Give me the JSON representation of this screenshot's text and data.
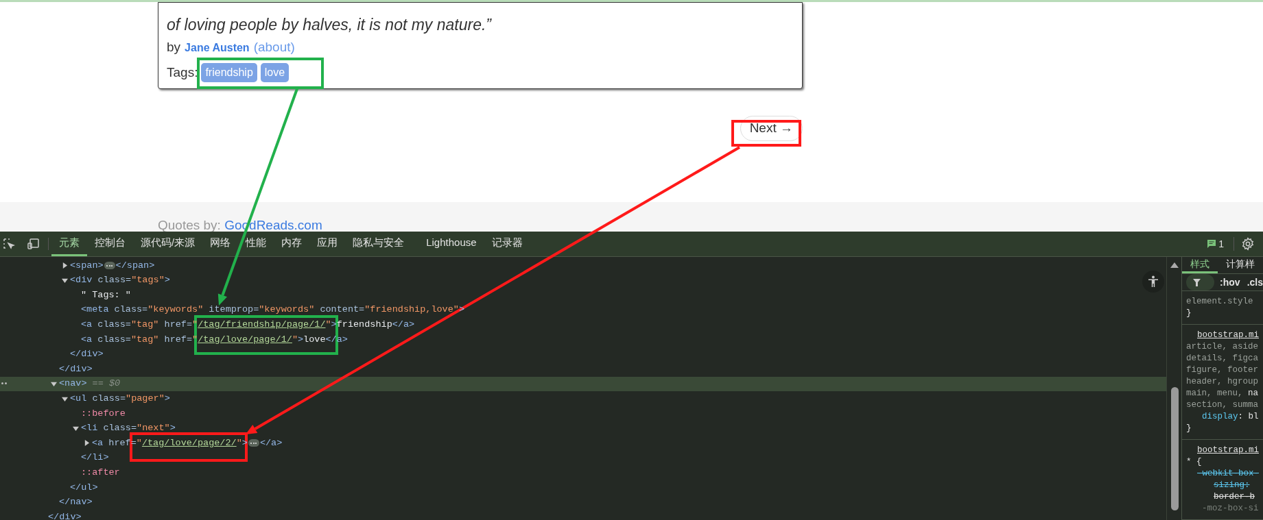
{
  "page": {
    "quote_lines": [
      "of loving people by halves, it is not my nature.”"
    ],
    "by_label": "by",
    "author": "Jane Austen",
    "about_link": "(about)",
    "tags_label": "Tags:",
    "tags": [
      "friendship",
      "love"
    ],
    "next_button": "Next →",
    "footer": {
      "label": "Quotes by:",
      "link": "GoodReads.com"
    }
  },
  "devtools": {
    "tabs": [
      {
        "label": "元素",
        "selected": true
      },
      {
        "label": "控制台",
        "selected": false
      },
      {
        "label": "源代码/来源",
        "selected": false
      },
      {
        "label": "网络",
        "selected": false
      },
      {
        "label": "性能",
        "selected": false
      },
      {
        "label": "内存",
        "selected": false
      },
      {
        "label": "应用",
        "selected": false
      },
      {
        "label": "隐私与安全",
        "selected": false
      },
      {
        "label": "Lighthouse",
        "selected": false
      },
      {
        "label": "记录器",
        "selected": false
      }
    ],
    "issues_count": "1",
    "dom_tree": [
      {
        "close": [
          {
            "kind": "tag",
            "text": "</div>"
          }
        ],
        "children": [
          {
            "close": [
              {
                "kind": "tag",
                "text": "</div>"
              }
            ],
            "children": [
              {
                "expanded": false,
                "selected": false,
                "open": [
                  {
                    "kind": "tag",
                    "text": "<span>"
                  },
                  {
                    "kind": "ellipsis"
                  },
                  {
                    "kind": "tag",
                    "text": "</span>"
                  }
                ]
              },
              {
                "expanded": true,
                "selected": false,
                "open": [
                  {
                    "kind": "tag",
                    "text": "<div"
                  },
                  {
                    "kind": "attr",
                    "text": " class="
                  },
                  {
                    "kind": "value",
                    "text": "\"tags\""
                  },
                  {
                    "kind": "tag",
                    "text": ">"
                  }
                ],
                "close": [
                  {
                    "kind": "tag",
                    "text": "</div>"
                  }
                ],
                "children": [
                  {
                    "selected": false,
                    "open": [
                      {
                        "kind": "text",
                        "text": "\" Tags: \""
                      }
                    ]
                  },
                  {
                    "selected": false,
                    "open": [
                      {
                        "kind": "tag",
                        "text": "<meta"
                      },
                      {
                        "kind": "attr",
                        "text": " class="
                      },
                      {
                        "kind": "value",
                        "text": "\"keywords\""
                      },
                      {
                        "kind": "attr",
                        "text": " itemprop="
                      },
                      {
                        "kind": "value",
                        "text": "\"keywords\""
                      },
                      {
                        "kind": "attr",
                        "text": " content="
                      },
                      {
                        "kind": "value",
                        "text": "\"friendship,love\""
                      },
                      {
                        "kind": "tag",
                        "text": ">"
                      }
                    ]
                  },
                  {
                    "selected": false,
                    "open": [
                      {
                        "kind": "tag",
                        "text": "<a"
                      },
                      {
                        "kind": "attr",
                        "text": " class="
                      },
                      {
                        "kind": "value",
                        "text": "\"tag\""
                      },
                      {
                        "kind": "attr",
                        "text": " href="
                      },
                      {
                        "kind": "value",
                        "text": "\""
                      },
                      {
                        "kind": "link",
                        "text": "/tag/friendship/page/1/"
                      },
                      {
                        "kind": "value",
                        "text": "\""
                      },
                      {
                        "kind": "tag",
                        "text": ">"
                      },
                      {
                        "kind": "text",
                        "text": "friendship"
                      },
                      {
                        "kind": "tag",
                        "text": "</a>"
                      }
                    ]
                  },
                  {
                    "selected": false,
                    "open": [
                      {
                        "kind": "tag",
                        "text": "<a"
                      },
                      {
                        "kind": "attr",
                        "text": " class="
                      },
                      {
                        "kind": "value",
                        "text": "\"tag\""
                      },
                      {
                        "kind": "attr",
                        "text": " href="
                      },
                      {
                        "kind": "value",
                        "text": "\""
                      },
                      {
                        "kind": "link",
                        "text": "/tag/love/page/1/"
                      },
                      {
                        "kind": "value",
                        "text": "\""
                      },
                      {
                        "kind": "tag",
                        "text": ">"
                      },
                      {
                        "kind": "text",
                        "text": "love"
                      },
                      {
                        "kind": "tag",
                        "text": "</a>"
                      }
                    ]
                  }
                ]
              }
            ]
          },
          {
            "expanded": true,
            "selected": true,
            "open": [
              {
                "kind": "tag",
                "text": "<nav>"
              },
              {
                "kind": "ref",
                "text": " == $0"
              }
            ],
            "close": [
              {
                "kind": "tag",
                "text": "</nav>"
              }
            ],
            "children": [
              {
                "expanded": true,
                "selected": false,
                "open": [
                  {
                    "kind": "tag",
                    "text": "<ul"
                  },
                  {
                    "kind": "attr",
                    "text": " class="
                  },
                  {
                    "kind": "value",
                    "text": "\"pager\""
                  },
                  {
                    "kind": "tag",
                    "text": ">"
                  }
                ],
                "close": [
                  {
                    "kind": "tag",
                    "text": "</ul>"
                  }
                ],
                "children": [
                  {
                    "selected": false,
                    "open": [
                      {
                        "kind": "pseudo",
                        "text": "::before"
                      }
                    ]
                  },
                  {
                    "expanded": true,
                    "selected": false,
                    "open": [
                      {
                        "kind": "tag",
                        "text": "<li"
                      },
                      {
                        "kind": "attr",
                        "text": " class="
                      },
                      {
                        "kind": "value",
                        "text": "\"next\""
                      },
                      {
                        "kind": "tag",
                        "text": ">"
                      }
                    ],
                    "close": [
                      {
                        "kind": "tag",
                        "text": "</li>"
                      }
                    ],
                    "children": [
                      {
                        "expanded": false,
                        "selected": false,
                        "open": [
                          {
                            "kind": "tag",
                            "text": "<a"
                          },
                          {
                            "kind": "attr",
                            "text": " href="
                          },
                          {
                            "kind": "value",
                            "text": "\""
                          },
                          {
                            "kind": "link",
                            "text": "/tag/love/page/2/"
                          },
                          {
                            "kind": "value",
                            "text": "\""
                          },
                          {
                            "kind": "tag",
                            "text": ">"
                          },
                          {
                            "kind": "ellipsis"
                          },
                          {
                            "kind": "tag",
                            "text": "</a>"
                          }
                        ]
                      }
                    ]
                  },
                  {
                    "selected": false,
                    "open": [
                      {
                        "kind": "pseudo",
                        "text": "::after"
                      }
                    ]
                  }
                ]
              }
            ]
          }
        ]
      }
    ],
    "styles_tabs": [
      {
        "label": "样式",
        "selected": true
      },
      {
        "label": "计算样",
        "selected": false
      }
    ],
    "filter_buttons": [
      ":hov",
      ".cls"
    ],
    "style_rules": [
      {
        "lines": [
          {
            "kind": "selector",
            "text": "element.style"
          },
          {
            "kind": "brace",
            "text": "}"
          }
        ]
      },
      {
        "lines": [
          {
            "kind": "source",
            "text": "bootstrap.mi"
          },
          {
            "kind": "selector",
            "text": "article, aside"
          },
          {
            "kind": "selector",
            "text": "details, figca"
          },
          {
            "kind": "selector",
            "text": "figure, footer"
          },
          {
            "kind": "selector",
            "text": "header, hgroup"
          },
          {
            "kind": "selector",
            "text": "main, menu, ",
            "match": "na"
          },
          {
            "kind": "selector",
            "text": "section, summa"
          },
          {
            "kind": "decl",
            "name": "display",
            "value": ": bl"
          },
          {
            "kind": "brace",
            "text": "}"
          }
        ]
      },
      {
        "lines": [
          {
            "kind": "source",
            "text": "bootstrap.mi"
          },
          {
            "kind": "brace",
            "text": "* {"
          },
          {
            "kind": "struck",
            "text": "-webkit-box-"
          },
          {
            "kind": "struck",
            "text": "sizing:",
            "indent": true
          },
          {
            "kind": "struck_plain",
            "text": "border-b",
            "indent": true
          },
          {
            "kind": "inactive",
            "text": "-moz-box-si"
          }
        ]
      }
    ]
  },
  "annotations": [
    {
      "kind": "box",
      "color": "#22b14c"
    },
    {
      "kind": "box",
      "color": "#22b14c"
    },
    {
      "kind": "arrow",
      "color": "#22b14c"
    },
    {
      "kind": "box",
      "color": "#ff1a1a"
    },
    {
      "kind": "box",
      "color": "#ff1a1a"
    },
    {
      "kind": "arrow",
      "color": "#ff1a1a"
    }
  ]
}
